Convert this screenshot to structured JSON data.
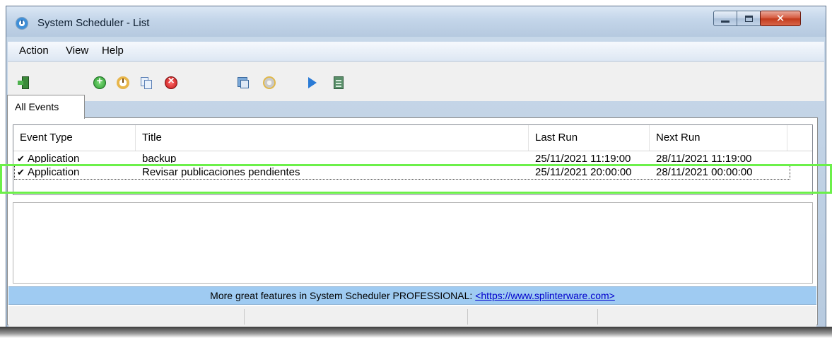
{
  "window": {
    "title": "System Scheduler - List"
  },
  "menu": {
    "items": [
      "Action",
      "View",
      "Help"
    ]
  },
  "toolbar": {
    "icons": [
      "exit-icon",
      "add-event-icon",
      "edit-event-icon",
      "copy-event-icon",
      "delete-event-icon",
      "properties-icon",
      "settings-icon",
      "run-now-icon",
      "log-icon"
    ]
  },
  "tabs": [
    {
      "label": "All Events"
    }
  ],
  "list": {
    "columns": [
      "Event Type",
      "Title",
      "Last Run",
      "Next Run"
    ],
    "rows": [
      {
        "checked": "✔",
        "event_type": "Application",
        "title": "backup",
        "last_run": "25/11/2021 11:19:00",
        "next_run": "28/11/2021 11:19:00"
      },
      {
        "checked": "✔",
        "event_type": "Application",
        "title": "Revisar publicaciones pendientes",
        "last_run": "25/11/2021 20:00:00",
        "next_run": "28/11/2021 00:00:00"
      }
    ]
  },
  "promo": {
    "text": "More great features in System Scheduler PROFESSIONAL: ",
    "link": "<https://www.splinterware.com>"
  },
  "colors": {
    "highlight": "#6cf04a",
    "promo_bg": "#9fcbf2",
    "close_button": "#c23a1c"
  }
}
